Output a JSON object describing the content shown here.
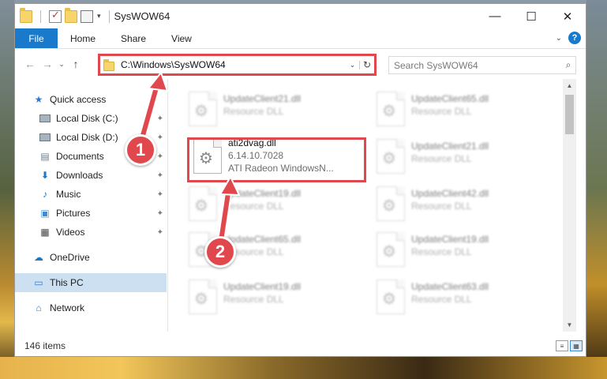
{
  "window": {
    "title": "SysWOW64",
    "minimize_glyph": "—",
    "maximize_glyph": "☐",
    "close_glyph": "✕"
  },
  "ribbon": {
    "tabs": [
      "File",
      "Home",
      "Share",
      "View"
    ],
    "help_glyph": "?",
    "expand_glyph": "⌄"
  },
  "nav": {
    "back_glyph": "←",
    "forward_glyph": "→",
    "recent_glyph": "⌄",
    "up_glyph": "↑"
  },
  "address": {
    "path": "C:\\Windows\\SysWOW64",
    "dropdown_glyph": "⌄",
    "refresh_glyph": "↻"
  },
  "search": {
    "placeholder": "Search SysWOW64",
    "icon_glyph": "⌕"
  },
  "sidebar": {
    "items": [
      {
        "label": "Quick access",
        "icon": "star-icon",
        "glyph": "★",
        "pinned": false
      },
      {
        "label": "Local Disk (C:)",
        "icon": "drive-icon",
        "glyph": "",
        "pinned": true
      },
      {
        "label": "Local Disk (D:)",
        "icon": "drive-icon",
        "glyph": "",
        "pinned": true
      },
      {
        "label": "Documents",
        "icon": "documents-icon",
        "glyph": "▤",
        "pinned": true
      },
      {
        "label": "Downloads",
        "icon": "downloads-icon",
        "glyph": "⬇",
        "pinned": true
      },
      {
        "label": "Music",
        "icon": "music-icon",
        "glyph": "♪",
        "pinned": true
      },
      {
        "label": "Pictures",
        "icon": "pictures-icon",
        "glyph": "▣",
        "pinned": true
      },
      {
        "label": "Videos",
        "icon": "videos-icon",
        "glyph": "▦",
        "pinned": true
      },
      {
        "label": "OneDrive",
        "icon": "onedrive-icon",
        "glyph": "☁",
        "pinned": false
      },
      {
        "label": "This PC",
        "icon": "this-pc-icon",
        "glyph": "▭",
        "pinned": false,
        "selected": true
      },
      {
        "label": "Network",
        "icon": "network-icon",
        "glyph": "⌂",
        "pinned": false
      }
    ],
    "pin_glyph": "✦"
  },
  "files": {
    "highlighted": {
      "name": "ati2dvag.dll",
      "version": "6.14.10.7028",
      "description": "ATI Radeon WindowsN..."
    },
    "background": [
      {
        "name": "UpdateClient21.dll",
        "type": "Resource DLL"
      },
      {
        "name": "UpdateClient65.dll",
        "type": "Resource DLL"
      },
      {
        "name": "UpdateClient21.dll",
        "type": "Resource DLL"
      },
      {
        "name": "UpdateClient19.dll",
        "type": "Resource DLL"
      },
      {
        "name": "UpdateClient42.dll",
        "type": "Resource DLL"
      },
      {
        "name": "UpdateClient65.dll",
        "type": "Resource DLL"
      },
      {
        "name": "UpdateClient19.dll",
        "type": "Resource DLL"
      },
      {
        "name": "UpdateClient19.dll",
        "type": "Resource DLL"
      },
      {
        "name": "UpdateClient63.dll",
        "type": "Resource DLL"
      }
    ]
  },
  "status": {
    "item_count": "146 items"
  },
  "annotations": {
    "step1": "1",
    "step2": "2",
    "color": "#e0484d"
  }
}
